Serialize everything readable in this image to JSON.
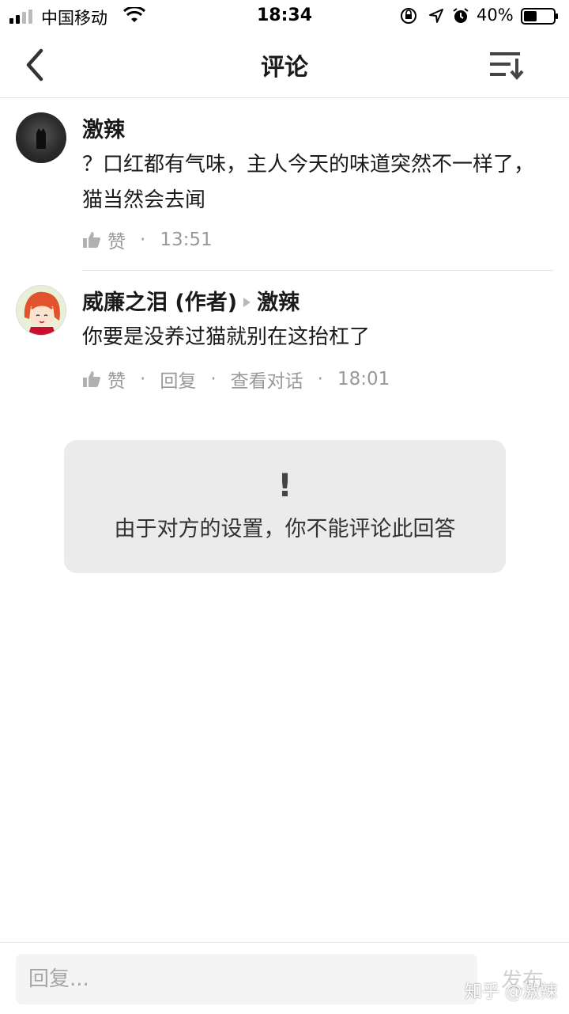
{
  "status_bar": {
    "carrier": "中国移动",
    "time": "18:34",
    "battery": "40%"
  },
  "nav": {
    "title": "评论",
    "back_icon": "chevron-left-icon",
    "sort_icon": "sort-icon"
  },
  "comments": [
    {
      "author": "激辣",
      "text": "？口红都有气味，主人今天的味道突然不一样了，猫当然会去闻",
      "like_label": "赞",
      "time": "13:51"
    },
    {
      "author": "威廉之泪 (作者)",
      "reply_to": "激辣",
      "text": "你要是没养过猫就别在这抬杠了",
      "like_label": "赞",
      "reply_label": "回复",
      "view_conversation_label": "查看对话",
      "time": "18:01"
    }
  ],
  "notice": {
    "icon": "!",
    "message": "由于对方的设置，你不能评论此回答"
  },
  "bottom_bar": {
    "placeholder": "回复...",
    "send_label": "发布"
  },
  "watermark": "知乎 @激辣",
  "colors": {
    "text_primary": "#1a1a1a",
    "text_secondary": "#999999",
    "notice_bg": "#ebebeb",
    "divider": "#e3e3e3"
  }
}
